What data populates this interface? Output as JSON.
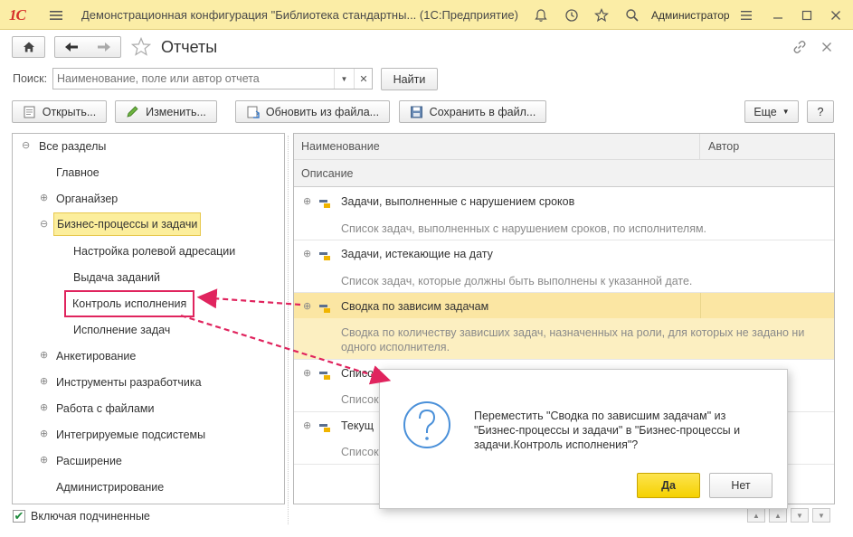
{
  "titlebar": {
    "logo": "1С",
    "title": "Демонстрационная конфигурация \"Библиотека стандартны...  (1С:Предприятие)",
    "user": "Администратор"
  },
  "header": {
    "page_title": "Отчеты"
  },
  "search": {
    "label": "Поиск:",
    "placeholder": "Наименование, поле или автор отчета",
    "find_label": "Найти"
  },
  "toolbar": {
    "open_label": "Открыть...",
    "edit_label": "Изменить...",
    "update_label": "Обновить из файла...",
    "save_label": "Сохранить в файл...",
    "more_label": "Еще",
    "help_label": "?"
  },
  "tree": {
    "items": [
      {
        "label": "Все разделы",
        "expander": "⊖"
      },
      {
        "label": "Главное",
        "expander": ""
      },
      {
        "label": "Органайзер",
        "expander": "⊕"
      },
      {
        "label": "Бизнес-процессы и задачи",
        "expander": "⊖"
      },
      {
        "label": "Настройка ролевой адресации",
        "expander": ""
      },
      {
        "label": "Выдача заданий",
        "expander": ""
      },
      {
        "label": "Контроль исполнения",
        "expander": ""
      },
      {
        "label": "Исполнение задач",
        "expander": ""
      },
      {
        "label": "Анкетирование",
        "expander": "⊕"
      },
      {
        "label": "Инструменты разработчика",
        "expander": "⊕"
      },
      {
        "label": "Работа с файлами",
        "expander": "⊕"
      },
      {
        "label": "Интегрируемые подсистемы",
        "expander": "⊕"
      },
      {
        "label": "Расширение",
        "expander": "⊕"
      },
      {
        "label": "Администрирование",
        "expander": ""
      }
    ],
    "include_subordinate": "Включая подчиненные"
  },
  "table": {
    "columns": {
      "name": "Наименование",
      "author": "Автор",
      "description": "Описание"
    },
    "rows": [
      {
        "name": "Задачи, выполненные с нарушением сроков",
        "description": "Список задач, выполненных с нарушением сроков, по исполнителям."
      },
      {
        "name": "Задачи, истекающие на дату",
        "description": "Список задач, которые должны быть выполнены к указанной дате."
      },
      {
        "name": "Сводка по зависим задачам",
        "description": "Сводка по количеству зависших задач, назначенных на роли, для которых не задано ни одного исполнителя."
      },
      {
        "name": "Список",
        "description": "Список"
      },
      {
        "name": "Текущ",
        "description": "Список"
      }
    ]
  },
  "dialog": {
    "message": "Переместить \"Сводка по зависшим задачам\" из \"Бизнес-процессы и задачи\" в \"Бизнес-процессы и задачи.Контроль исполнения\"?",
    "yes_label": "Да",
    "no_label": "Нет",
    "icon": "question-icon"
  },
  "colors": {
    "titlebar_bg": "#fbeda6",
    "selection_bg": "#fcee9c",
    "highlight_row": "#fcefc1",
    "accent_arrow": "#e0245e",
    "dialog_icon": "#4a90d9",
    "yes_button": "#f5d100"
  }
}
